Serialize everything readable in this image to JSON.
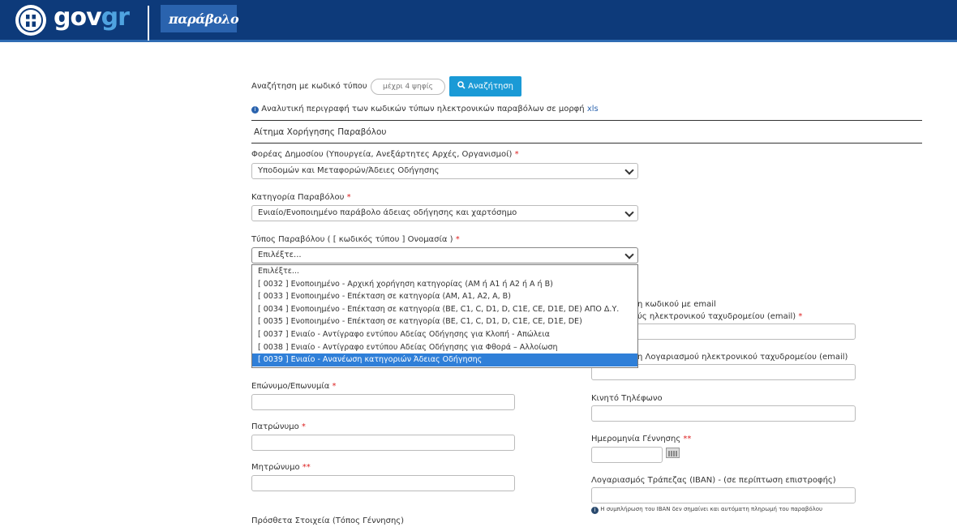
{
  "header": {
    "brand_gov": "gov",
    "brand_gr": "gr",
    "service_logo": "παράβολο"
  },
  "search": {
    "label": "Αναζήτηση με κωδικό τύπου",
    "placeholder": "μέχρι 4 ψηφίς",
    "button": "Αναζήτηση",
    "info_text": "Αναλυτική περιγραφή των κωδικών τύπων ηλεκτρονικών παραβόλων σε μορφή",
    "info_link": "xls"
  },
  "section_title": "Αίτημα Χορήγησης Παραβόλου",
  "fields": {
    "agency_label": "Φορέας Δημοσίου (Υπουργεία, Ανεξάρτητες Αρχές, Οργανισμοί)",
    "agency_value": "Υποδομών και Μεταφορών/Άδειες Οδήγησης",
    "category_label": "Κατηγορία Παραβόλου",
    "category_value": "Ενιαίο/Ενοποιημένο παράβολο άδειας οδήγησης και χαρτόσημο",
    "type_label": "Τύπος Παραβόλου ( [ κωδικός τύπου ] Ονομασία )",
    "type_value": "Επιλέξτε...",
    "email_partial_1": "η κωδικού με email",
    "email_partial_2": "ύς ηλεκτρονικού ταχυδρομείου (email)",
    "email_confirm_partial": "η Λογαριασμού ηλεκτρονικού ταχυδρομείου (email)",
    "surname_label": "Επώνυμο/Επωνυμία",
    "mobile_label": "Κινητό Τηλέφωνο",
    "father_label": "Πατρώνυμο",
    "birthdate_label": "Ημερομηνία Γέννησης",
    "mother_label": "Μητρώνυμο",
    "iban_label": "Λογαριασμός Τράπεζας (IBAN) - (σε περίπτωση επιστροφής)",
    "iban_note": "Η συμπλήρωση του IBAN δεν σημαίνει και αυτόματη πληρωμή του παραβόλου",
    "extra_label": "Πρόσθετα Στοιχεία (Τόπος Γέννησης)"
  },
  "required_single": "*",
  "required_double": "**",
  "dropdown_options": [
    "Επιλέξτε...",
    "[ 0032 ] Ενοποιημένο - Αρχική χορήγηση κατηγορίας (ΑΜ ή Α1 ή Α2 ή Α ή Β)",
    "[ 0033 ] Ενοποιημένο - Επέκταση σε κατηγορία (ΑΜ, Α1, Α2, Α, Β)",
    "[ 0034 ] Ενοποιημένο - Επέκταση σε κατηγορία (ΒΕ, C1, C, D1, D, C1E, CE, D1E, DE) ΑΠΟ Δ.Υ.",
    "[ 0035 ] Ενοποιημένο - Επέκταση σε κατηγορία (ΒΕ, C1, C, D1, D, C1E, CE, D1E, DE)",
    "[ 0037 ] Ενιαίο - Αντίγραφο εντύπου Αδείας Οδήγησης για Κλοπή - Απώλεια",
    "[ 0038 ] Ενιαίο - Αντίγραφο εντύπου Αδείας Οδήγησης για Φθορά – Αλλοίωση",
    "[ 0039 ] Ενιαίο - Ανανέωση κατηγοριών Άδειας Οδήγησης"
  ],
  "dropdown_highlighted_index": 7,
  "colors": {
    "header_bg": "#0d3a7a",
    "search_button": "#1a9ad6",
    "highlight": "#2f7fd8",
    "required": "#d22222"
  }
}
